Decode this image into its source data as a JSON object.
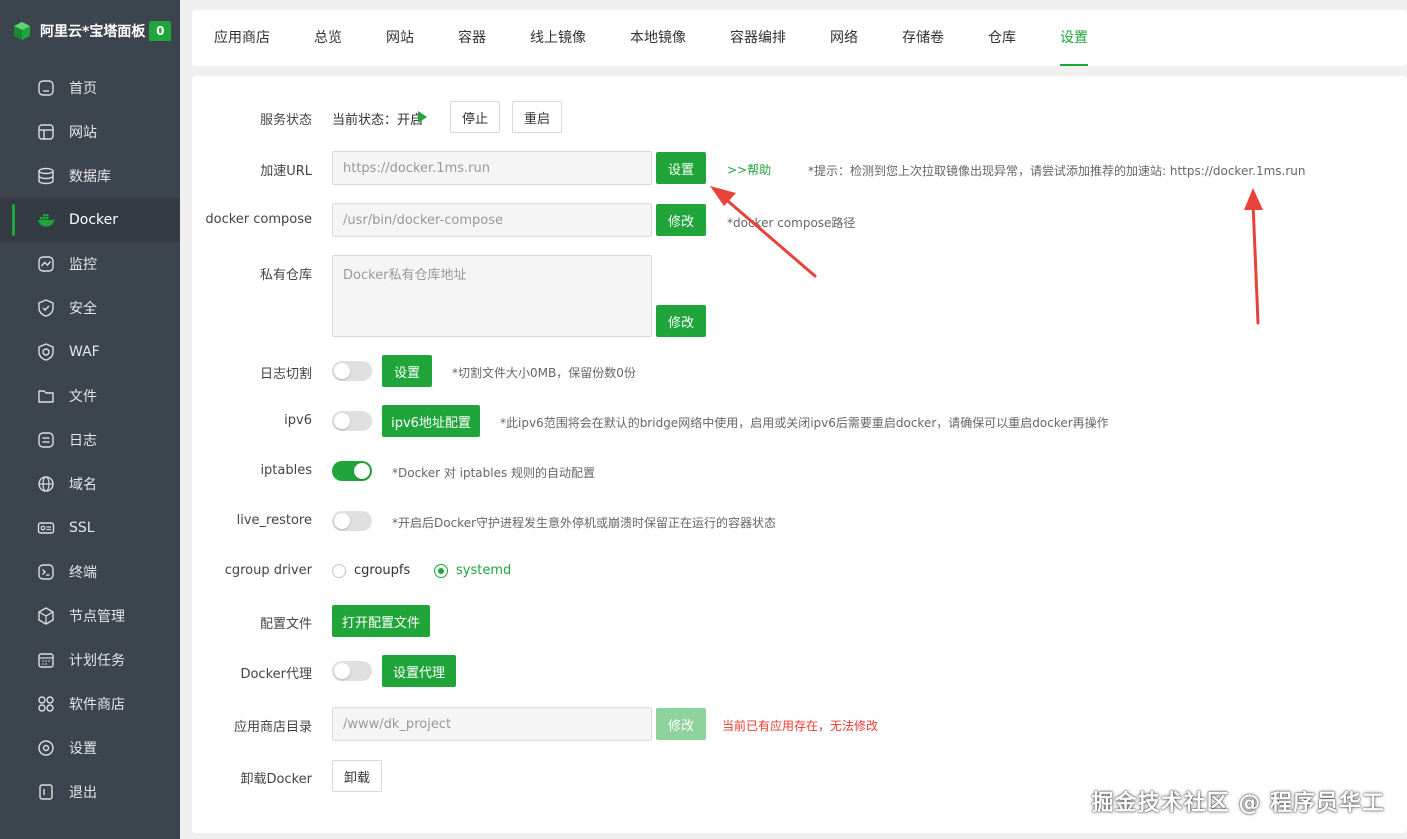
{
  "brand": {
    "name": "阿里云*宝塔面板",
    "badge": "0"
  },
  "sidebar": {
    "items": [
      {
        "label": "首页",
        "icon": "home-icon"
      },
      {
        "label": "网站",
        "icon": "website-icon"
      },
      {
        "label": "数据库",
        "icon": "database-icon"
      },
      {
        "label": "Docker",
        "icon": "docker-icon",
        "active": true
      },
      {
        "label": "监控",
        "icon": "monitor-icon"
      },
      {
        "label": "安全",
        "icon": "shield-icon"
      },
      {
        "label": "WAF",
        "icon": "waf-icon"
      },
      {
        "label": "文件",
        "icon": "folder-icon"
      },
      {
        "label": "日志",
        "icon": "log-icon"
      },
      {
        "label": "域名",
        "icon": "globe-icon"
      },
      {
        "label": "SSL",
        "icon": "ssl-icon"
      },
      {
        "label": "终端",
        "icon": "terminal-icon"
      },
      {
        "label": "节点管理",
        "icon": "node-icon"
      },
      {
        "label": "计划任务",
        "icon": "calendar-icon"
      },
      {
        "label": "软件商店",
        "icon": "apps-icon"
      },
      {
        "label": "设置",
        "icon": "gear-icon"
      },
      {
        "label": "退出",
        "icon": "logout-icon"
      }
    ]
  },
  "tabs": [
    {
      "label": "应用商店"
    },
    {
      "label": "总览"
    },
    {
      "label": "网站"
    },
    {
      "label": "容器"
    },
    {
      "label": "线上镜像"
    },
    {
      "label": "本地镜像"
    },
    {
      "label": "容器编排"
    },
    {
      "label": "网络"
    },
    {
      "label": "存储卷"
    },
    {
      "label": "仓库"
    },
    {
      "label": "设置",
      "active": true
    }
  ],
  "settings": {
    "service_status": {
      "label": "服务状态",
      "status_text": "当前状态：开启",
      "stop_label": "停止",
      "restart_label": "重启"
    },
    "mirror_url": {
      "label": "加速URL",
      "value": "https://docker.1ms.run",
      "button": "设置",
      "help_link": ">>帮助",
      "hint": "*提示：检测到您上次拉取镜像出现异常，请尝试添加推荐的加速站: https://docker.1ms.run"
    },
    "compose": {
      "label": "docker compose",
      "placeholder": "/usr/bin/docker-compose",
      "button": "修改",
      "hint": "*docker compose路径"
    },
    "registry": {
      "label": "私有仓库",
      "placeholder": "Docker私有仓库地址",
      "button": "修改"
    },
    "log_rotate": {
      "label": "日志切割",
      "enabled": false,
      "button": "设置",
      "hint": "*切割文件大小0MB，保留份数0份"
    },
    "ipv6": {
      "label": "ipv6",
      "enabled": false,
      "button": "ipv6地址配置",
      "hint": "*此ipv6范围将会在默认的bridge网络中使用，启用或关闭ipv6后需要重启docker，请确保可以重启docker再操作"
    },
    "iptables": {
      "label": "iptables",
      "enabled": true,
      "hint": "*Docker 对 iptables 规则的自动配置"
    },
    "live_restore": {
      "label": "live_restore",
      "enabled": false,
      "hint": "*开启后Docker守护进程发生意外停机或崩溃时保留正在运行的容器状态"
    },
    "cgroup": {
      "label": "cgroup driver",
      "options": [
        "cgroupfs",
        "systemd"
      ],
      "selected": "systemd"
    },
    "config_file": {
      "label": "配置文件",
      "button": "打开配置文件"
    },
    "proxy": {
      "label": "Docker代理",
      "enabled": false,
      "button": "设置代理"
    },
    "app_dir": {
      "label": "应用商店目录",
      "placeholder": "/www/dk_project",
      "button": "修改",
      "warning": "当前已有应用存在，无法修改"
    },
    "uninstall": {
      "label": "卸载Docker",
      "button": "卸载"
    }
  },
  "watermark": "掘金技术社区 @ 程序员华工",
  "colors": {
    "accent": "#20a53a",
    "sidebar": "#3c444d",
    "annotation_red": "#e8433b",
    "warning": "#e63b2e"
  }
}
